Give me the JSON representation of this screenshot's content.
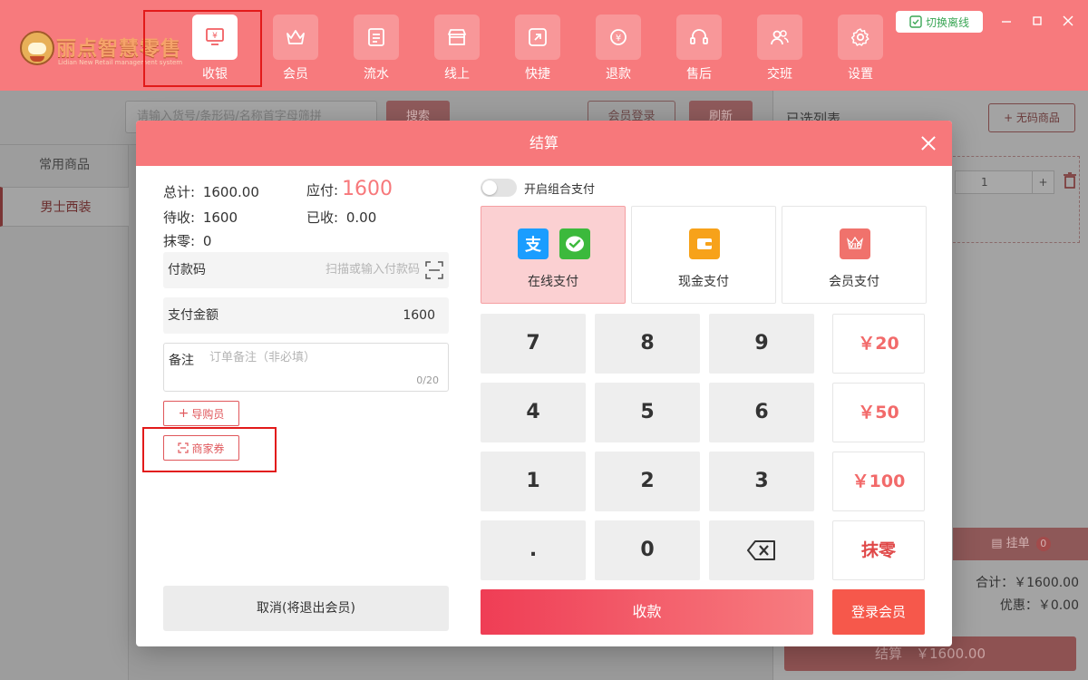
{
  "app": {
    "logo_title": "丽点智慧零售",
    "logo_subtitle": "Lidian New Retail management system",
    "offline_label": "切换离线"
  },
  "nav": [
    {
      "label": "收银",
      "icon": "cashier-icon",
      "active": true
    },
    {
      "label": "会员",
      "icon": "crown-icon"
    },
    {
      "label": "流水",
      "icon": "ledger-icon"
    },
    {
      "label": "线上",
      "icon": "store-icon"
    },
    {
      "label": "快捷",
      "icon": "shortcut-icon"
    },
    {
      "label": "退款",
      "icon": "refund-icon"
    },
    {
      "label": "售后",
      "icon": "headset-icon"
    },
    {
      "label": "交班",
      "icon": "handover-icon"
    },
    {
      "label": "设置",
      "icon": "gear-icon"
    }
  ],
  "background": {
    "search_placeholder": "请输入货号/条形码/名称首字母筛拼",
    "search_button": "搜索",
    "member_login": "会员登录",
    "refresh": "刷新",
    "categories": [
      "常用商品",
      "男士西装"
    ],
    "selected_list_title": "已选列表",
    "no_code_item": "+ 无码商品",
    "qty_value": "1",
    "hold_label": "挂单",
    "hold_count": "0",
    "total": "合计：￥1600.00",
    "discount": "优惠：￥0.00",
    "checkout": "结算　￥1600.00"
  },
  "modal": {
    "title": "结算",
    "summary": {
      "total_label": "总计:",
      "total_value": "1600.00",
      "payable_label": "应付:",
      "payable_value": "1600",
      "pending_label": "待收:",
      "pending_value": "1600",
      "received_label": "已收:",
      "received_value": "0.00",
      "rounding_label": "抹零:",
      "rounding_value": "0"
    },
    "pay_code_label": "付款码",
    "pay_code_placeholder": "扫描或输入付款码",
    "pay_amount_label": "支付金额",
    "pay_amount_value": "1600",
    "remark_label": "备注",
    "remark_placeholder": "订单备注（非必填）",
    "remark_count": "0/20",
    "guide_button": "导购员",
    "coupon_button": "商家券",
    "cancel_button": "取消(将退出会员)",
    "combo_label": "开启组合支付",
    "pay_methods": [
      {
        "label": "在线支付",
        "active": true
      },
      {
        "label": "现金支付"
      },
      {
        "label": "会员支付"
      }
    ],
    "keys": [
      "7",
      "8",
      "9",
      "4",
      "5",
      "6",
      "1",
      "2",
      "3",
      ".",
      "0"
    ],
    "quick_amounts": [
      "￥20",
      "￥50",
      "￥100"
    ],
    "round_off": "抹零",
    "collect_button": "收款",
    "login_member_button": "登录会员",
    "colors": {
      "accent": "#f7787b",
      "active_pay": "#fbd0d2",
      "alipay": "#1a9dff",
      "wechat": "#3cb93c",
      "cash": "#f7a21a",
      "vip": "#f0726c"
    }
  }
}
